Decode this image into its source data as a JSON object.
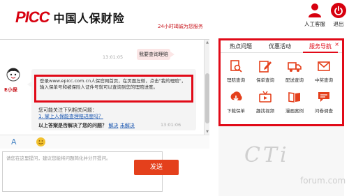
{
  "header": {
    "logo_mark": "PICC",
    "logo_text": "中国人保财险",
    "slogan": "24小时竭诚为您服务",
    "agent_label": "人工客服",
    "exit_label": "退出"
  },
  "chat": {
    "time1": "13:01:05",
    "user_message": "我要查询理赔",
    "time2": "13:01:06",
    "bot_name": "E小保",
    "answer": "登录www.epicc.com.cn人保官网首页，在页面左侧，点击\"我的理赔\"，输入保单号和被保险人证件号就可以查询到您的理赔进度。",
    "related_title": "您可能关注下列相关问题：",
    "related_link": "1. 掌上人保能查理赔进度吗？",
    "feedback_prompt": "以上答案是否解决了您的问题？",
    "feedback_yes": "解决",
    "feedback_no": "未解决"
  },
  "toolbar": {
    "font_icon": "A"
  },
  "input": {
    "placeholder": "请您在这里提问，建议您能将问题简化并分开提问。",
    "send_label": "发送"
  },
  "panel": {
    "tabs": [
      "热点问题",
      "优惠活动",
      "服务导航"
    ],
    "active_tab": 2,
    "close": "×",
    "items": [
      {
        "label": "理赔查询",
        "icon": "search-doc-icon"
      },
      {
        "label": "保单查询",
        "icon": "edit-doc-icon"
      },
      {
        "label": "配送查询",
        "icon": "truck-icon"
      },
      {
        "label": "中奖查询",
        "icon": "envelope-icon"
      },
      {
        "label": "下载保单",
        "icon": "download-icon"
      },
      {
        "label": "趣找视频",
        "icon": "tv-icon"
      },
      {
        "label": "漫画案例",
        "icon": "book-icon"
      },
      {
        "label": "问卷调查",
        "icon": "chat-icon"
      }
    ]
  },
  "watermark": {
    "main": "CTi",
    "sub": "forum.com"
  },
  "colors": {
    "brand_red": "#d7000f",
    "highlight_red": "#e10a18",
    "send_orange": "#e4401c",
    "link_blue": "#1a56b0"
  }
}
